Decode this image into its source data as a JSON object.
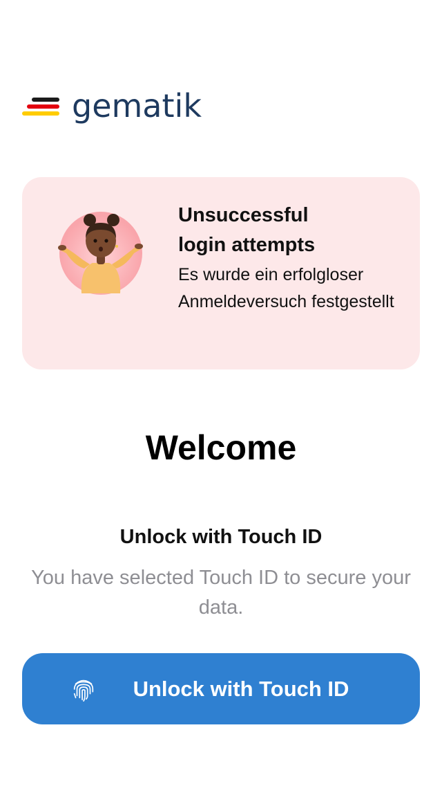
{
  "logo": {
    "text": "gematik",
    "colors": {
      "black": "#1b1b1b",
      "red": "#e3000f",
      "gold": "#ffcc00",
      "text": "#1e3a5f"
    }
  },
  "alert": {
    "title": "Unsuccessful login attempts",
    "message": "Es wurde ein erfolgloser Anmeldeversuch festgestellt",
    "illustration": "shrugging-person-illustration",
    "background_color": "#fde8e9"
  },
  "welcome": {
    "title": "Welcome"
  },
  "unlock": {
    "heading": "Unlock with Touch ID",
    "description": "You have selected Touch ID to secure your data.",
    "button_label": "Unlock with Touch ID",
    "button_icon": "fingerprint-icon",
    "button_color": "#2f80d1"
  }
}
